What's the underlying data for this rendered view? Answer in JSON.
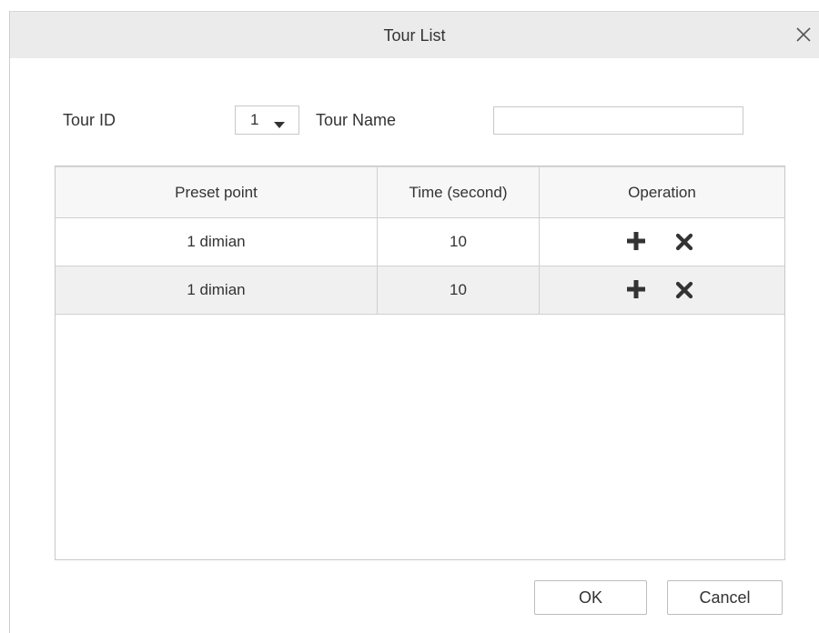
{
  "dialog": {
    "title": "Tour List",
    "close_icon": "close-icon"
  },
  "form": {
    "tour_id_label": "Tour ID",
    "tour_id_value": "1",
    "tour_name_label": "Tour Name",
    "tour_name_value": ""
  },
  "table": {
    "columns": [
      "Preset point",
      "Time (second)",
      "Operation"
    ],
    "rows": [
      {
        "preset": "1  dimian",
        "time": "10",
        "ops": [
          "add-icon",
          "delete-icon"
        ]
      },
      {
        "preset": "1  dimian",
        "time": "10",
        "ops": [
          "add-icon",
          "delete-icon"
        ]
      }
    ]
  },
  "footer": {
    "ok_label": "OK",
    "cancel_label": "Cancel"
  }
}
